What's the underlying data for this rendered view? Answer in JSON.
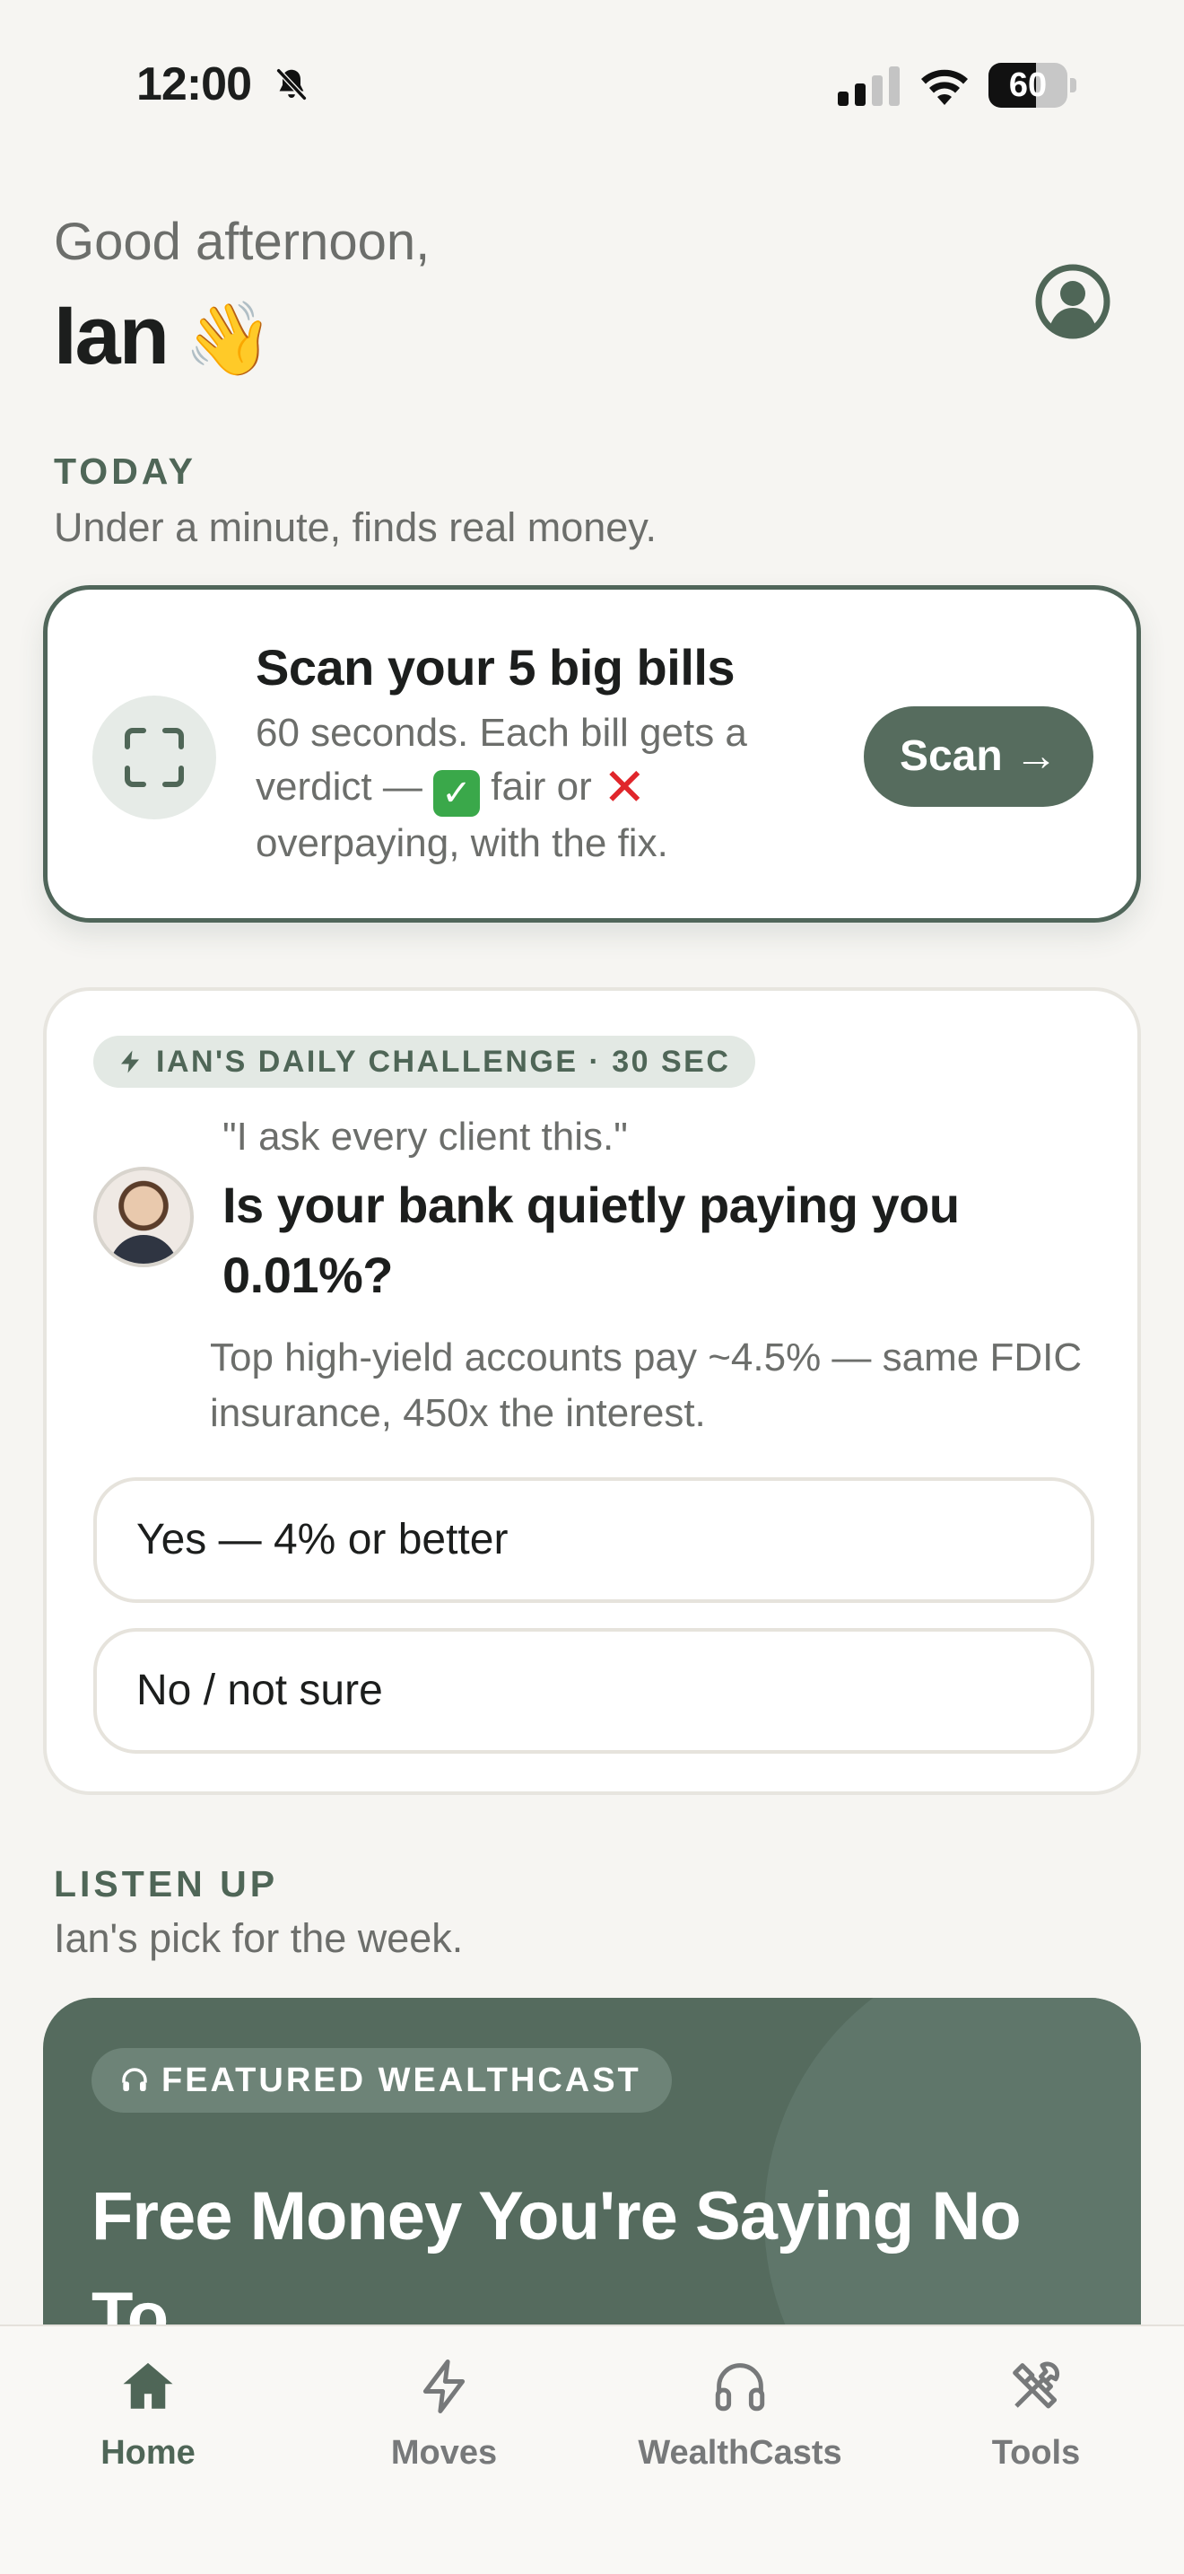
{
  "status_bar": {
    "time": "12:00",
    "battery_level": "60",
    "battery_fraction": 0.6
  },
  "header": {
    "greeting": "Good afternoon,",
    "user_name": "Ian",
    "wave_emoji": "👋",
    "profile_icon": "user-circle-icon"
  },
  "today": {
    "title": "TODAY",
    "subtitle": "Under a minute, finds real money."
  },
  "scan_card": {
    "icon": "scan-frame-icon",
    "title": "Scan your 5 big bills",
    "desc_part1": "60 seconds. Each bill gets a verdict — ",
    "check_emoji": "✅",
    "desc_part2": " fair or ",
    "cross_emoji": "❌",
    "desc_part3": " overpaying, with the fix.",
    "button_label": "Scan →"
  },
  "challenge": {
    "badge_icon": "lightning-icon",
    "badge": "IAN'S DAILY CHALLENGE · 30 SEC",
    "quote": "\"I ask every client this.\"",
    "question": "Is your bank quietly paying you 0.01%?",
    "description": "Top high-yield accounts pay ~4.5% — same FDIC insurance, 450x the interest.",
    "options": [
      "Yes — 4% or better",
      "No / not sure"
    ]
  },
  "listen_up": {
    "title": "LISTEN UP",
    "subtitle": "Ian's pick for the week."
  },
  "wealthcast": {
    "badge_icon": "headphones-icon",
    "badge": "FEATURED WEALTHCAST",
    "title": "Free Money You're Saying No To"
  },
  "tabs": [
    {
      "label": "Home",
      "icon": "home-icon",
      "active": true
    },
    {
      "label": "Moves",
      "icon": "lightning-icon",
      "active": false
    },
    {
      "label": "WealthCasts",
      "icon": "headphones-icon",
      "active": false
    },
    {
      "label": "Tools",
      "icon": "tools-icon",
      "active": false
    }
  ],
  "colors": {
    "primary": "#566c5e",
    "background": "#f6f5f2",
    "muted_text": "#6c6e6b",
    "section_title": "#4f6657"
  }
}
